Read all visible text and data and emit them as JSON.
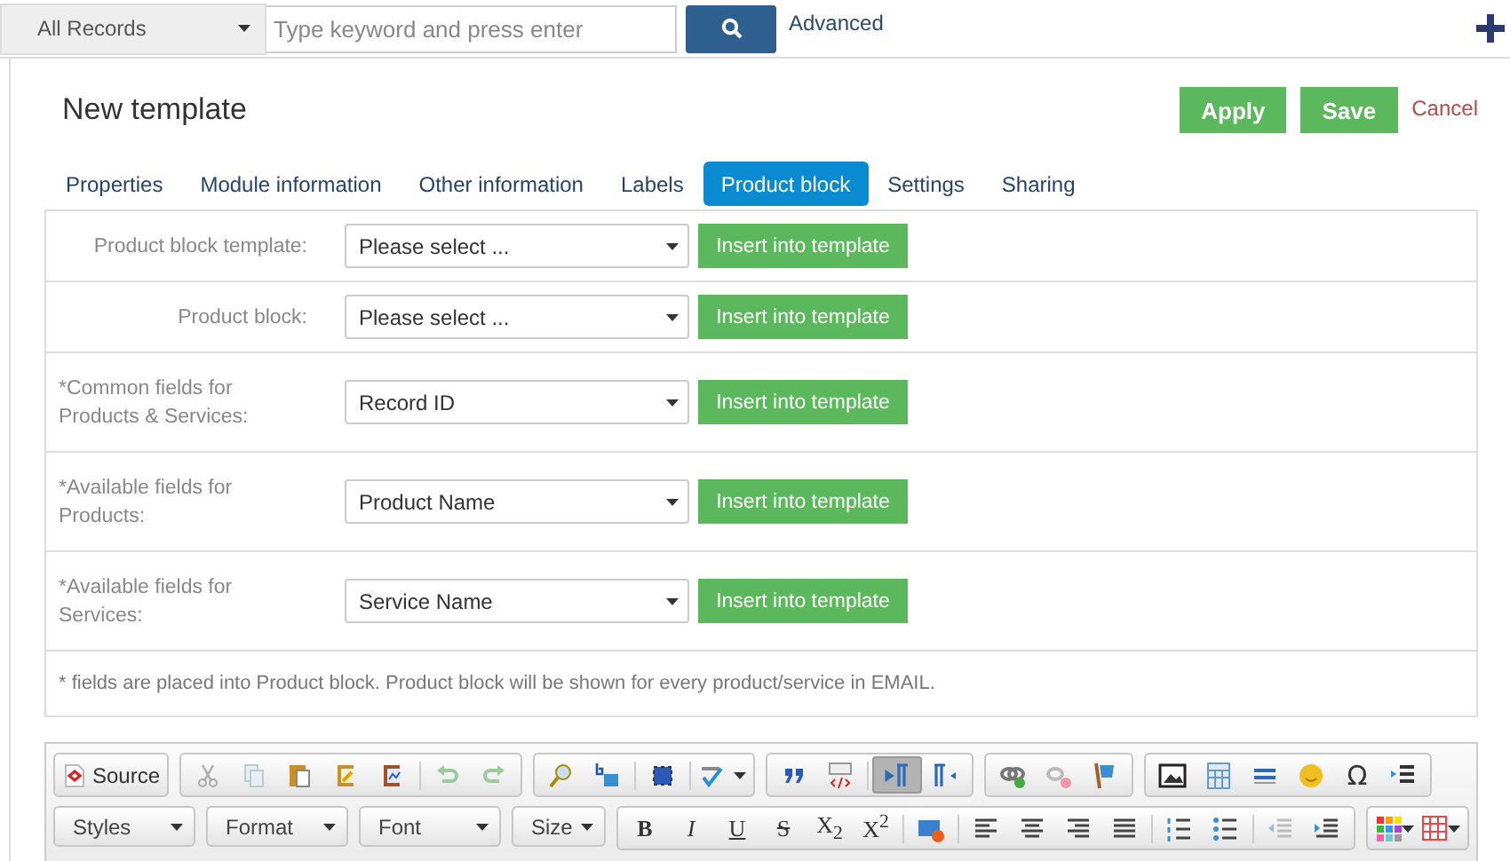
{
  "search_bar": {
    "scope": "All Records",
    "placeholder": "Type keyword and press enter",
    "advanced_link": "Advanced"
  },
  "header": {
    "title": "New template",
    "buttons": [
      {
        "label": "Apply",
        "kind": "primary"
      },
      {
        "label": "Save",
        "kind": "primary"
      },
      {
        "label": "Cancel",
        "kind": "link"
      }
    ]
  },
  "tabs": [
    {
      "label": "Properties",
      "selected": false
    },
    {
      "label": "Module information",
      "selected": false
    },
    {
      "label": "Other information",
      "selected": false
    },
    {
      "label": "Labels",
      "selected": false
    },
    {
      "label": "Product block",
      "selected": true
    },
    {
      "label": "Settings",
      "selected": false
    },
    {
      "label": "Sharing",
      "selected": false
    }
  ],
  "form": {
    "rows": [
      {
        "label": "Product block template:",
        "kind": "block",
        "value": "Please select ...",
        "button": "Insert into template"
      },
      {
        "label": "Product block:",
        "kind": "block",
        "value": "Please select ...",
        "button": "Insert into template"
      },
      {
        "label": "*Common fields for Products & Services:",
        "kind": "field",
        "value": "Record ID",
        "button": "Insert into template"
      },
      {
        "label": "*Available fields for Products:",
        "kind": "field",
        "value": "Product Name",
        "button": "Insert into template"
      },
      {
        "label": "*Available fields for Services:",
        "kind": "field",
        "value": "Service Name",
        "button": "Insert into template"
      }
    ],
    "note": "* fields are placed into Product block. Product block will be shown for every product/service in EMAIL."
  },
  "editor_toolbar": {
    "source_label": "Source",
    "combos": [
      "Styles",
      "Format",
      "Font",
      "Size"
    ],
    "format_buttons": [
      "B",
      "I",
      "U",
      "S",
      "X$_{2}$",
      "X$^{2}$"
    ],
    "special_char": "Ω",
    "ltr_pressed": true
  }
}
